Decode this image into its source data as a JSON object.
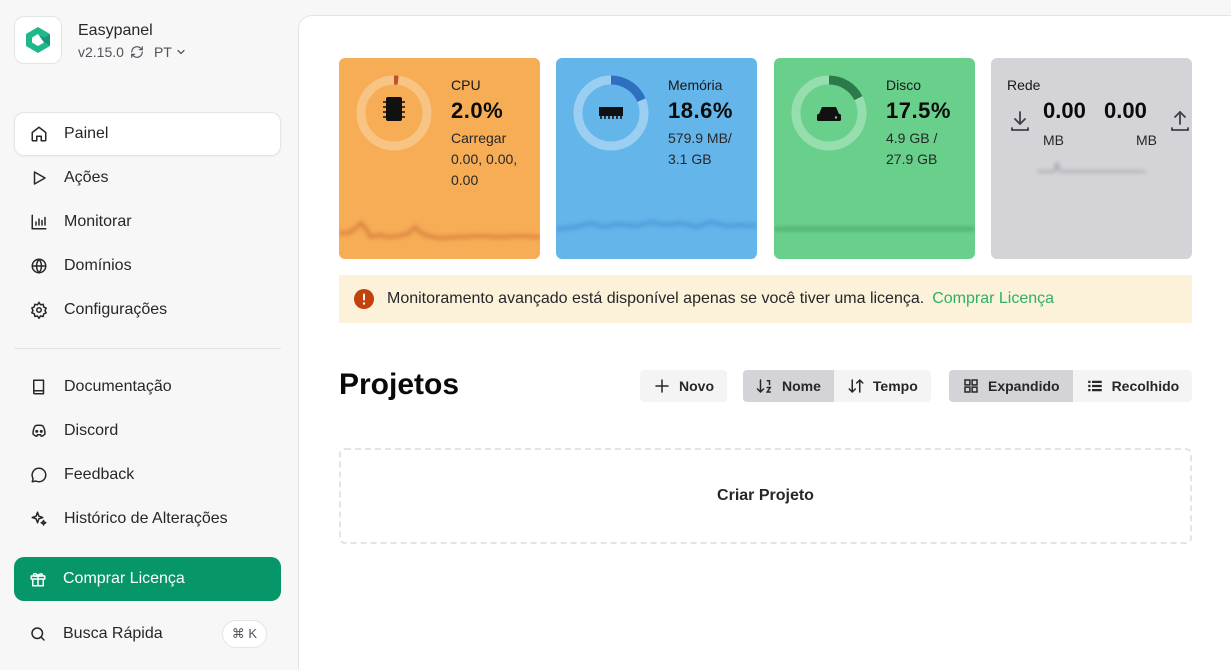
{
  "brand": {
    "name": "Easypanel",
    "version": "v2.15.0",
    "language": "PT",
    "accent": "#1fb88a"
  },
  "sidebar": {
    "primary": [
      {
        "label": "Painel",
        "icon": "home-icon",
        "active": true
      },
      {
        "label": "Ações",
        "icon": "play-icon"
      },
      {
        "label": "Monitorar",
        "icon": "bar-chart-icon"
      },
      {
        "label": "Domínios",
        "icon": "globe-icon"
      },
      {
        "label": "Configurações",
        "icon": "gear-icon"
      }
    ],
    "secondary": [
      {
        "label": "Documentação",
        "icon": "book-icon"
      },
      {
        "label": "Discord",
        "icon": "discord-icon"
      },
      {
        "label": "Feedback",
        "icon": "message-icon"
      },
      {
        "label": "Histórico de Alterações",
        "icon": "sparkles-icon"
      }
    ],
    "cta": {
      "label": "Comprar Licença",
      "icon": "gift-icon",
      "color": "#079669"
    },
    "search": {
      "label": "Busca Rápida",
      "shortcut": "⌘ K",
      "icon": "search-icon"
    }
  },
  "stats": {
    "cpu": {
      "label": "CPU",
      "value": "2.0%",
      "sub": "Carregar 0.00, 0.00, 0.00",
      "percent": 2.0,
      "color": "#f6ad55",
      "icon": "chip-icon"
    },
    "memory": {
      "label": "Memória",
      "value": "18.6%",
      "sub": "579.9 MB/ 3.1 GB",
      "percent": 18.6,
      "color": "#64b5ea",
      "icon": "memory-icon"
    },
    "disk": {
      "label": "Disco",
      "value": "17.5%",
      "sub": "4.9 GB / 27.9 GB",
      "percent": 17.5,
      "color": "#69d08b",
      "icon": "hard-drive-icon"
    },
    "network": {
      "label": "Rede",
      "download_value": "0.00",
      "download_unit": "MB",
      "upload_value": "0.00",
      "upload_unit": "MB",
      "color": "#d4d4d8"
    }
  },
  "alert": {
    "text": "Monitoramento avançado está disponível apenas se você tiver uma licença.",
    "link": "Comprar Licença",
    "icon": "alert-circle-icon"
  },
  "projects": {
    "title": "Projetos",
    "new_label": "Novo",
    "sort": [
      {
        "label": "Nome",
        "active": true
      },
      {
        "label": "Tempo",
        "active": false
      }
    ],
    "view": [
      {
        "label": "Expandido",
        "active": true
      },
      {
        "label": "Recolhido",
        "active": false
      }
    ],
    "empty_label": "Criar Projeto"
  }
}
